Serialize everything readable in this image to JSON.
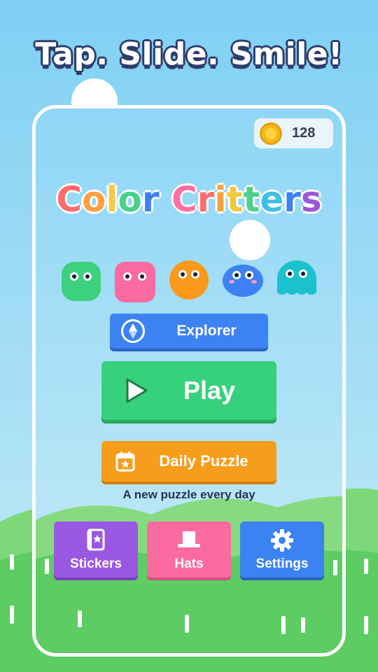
{
  "headline": "Tap. Slide. Smile!",
  "coins": {
    "count": "128",
    "icon": "coin-icon"
  },
  "title": {
    "text": "Color Critters",
    "letter_colors": [
      "#ff6b6b",
      "#ff9f43",
      "#f7c948",
      "#4cd08a",
      "#3d82f2",
      "#ffffff",
      "#ff6fa5",
      "#ff6b6b",
      "#f7a23c",
      "#f0c83a",
      "#4cd08a",
      "#3ec1e6",
      "#3d82f2",
      "#9b59d9"
    ]
  },
  "critters": [
    {
      "name": "green-critter",
      "color": "#3dd17d"
    },
    {
      "name": "pink-critter",
      "color": "#fb6ba0"
    },
    {
      "name": "orange-critter",
      "color": "#f99a1c"
    },
    {
      "name": "blue-critter",
      "color": "#3d82f2"
    },
    {
      "name": "teal-critter",
      "color": "#1cc1cf"
    }
  ],
  "buttons": {
    "explorer": {
      "label": "Explorer",
      "icon": "compass-icon",
      "color": "#3d82f2"
    },
    "play": {
      "label": "Play",
      "icon": "play-icon",
      "color": "#37d17c"
    },
    "daily": {
      "label": "Daily Puzzle",
      "icon": "calendar-star-icon",
      "color": "#f79d1c",
      "subtitle": "A new puzzle every day"
    }
  },
  "tiles": [
    {
      "label": "Stickers",
      "icon": "sticker-book-icon",
      "color": "#9a58e2"
    },
    {
      "label": "Hats",
      "icon": "top-hat-icon",
      "color": "#fb6ba0"
    },
    {
      "label": "Settings",
      "icon": "gear-icon",
      "color": "#3d82f2"
    }
  ]
}
